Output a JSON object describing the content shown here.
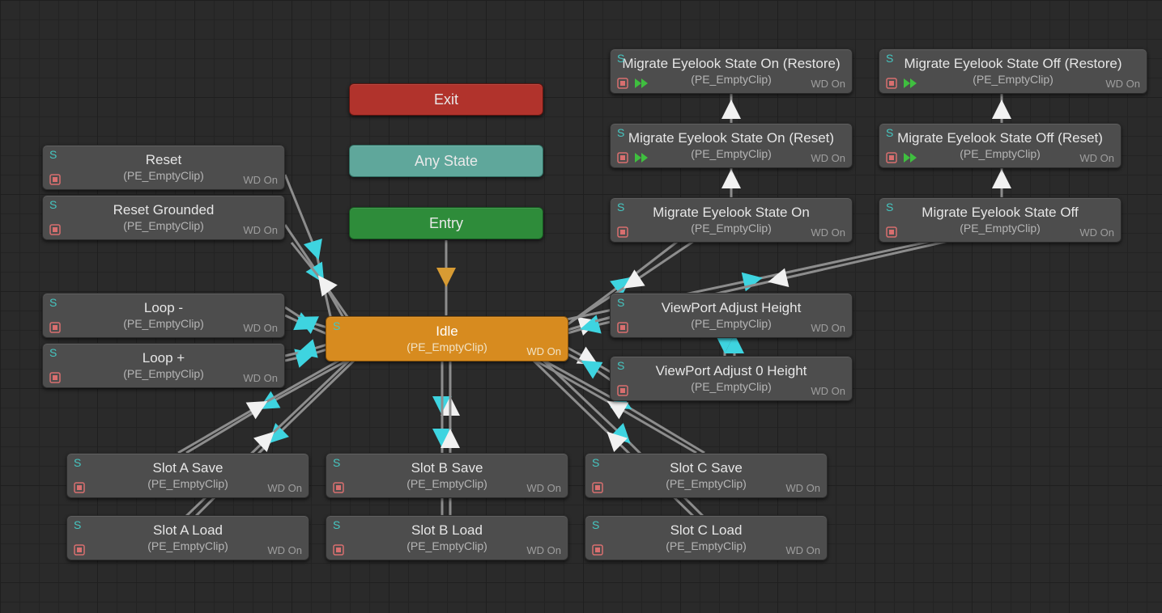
{
  "colors": {
    "idle": "#d78b1f",
    "exit": "#b1332c",
    "anyState": "#5fa79b",
    "entry": "#2e8c3a",
    "state": "#4d4d4d",
    "sTag": "#45c6c1",
    "arrowCyan": "#3ed4e0",
    "arrowWhite": "#f1f1f1",
    "micIcon": "#d86f6f",
    "ffIcon": "#3fbf3f"
  },
  "wd": "WD On",
  "sTag": "S",
  "clip": "(PE_EmptyClip)",
  "nodes": {
    "exit": {
      "label": "Exit"
    },
    "anyState": {
      "label": "Any State"
    },
    "entry": {
      "label": "Entry"
    },
    "idle": {
      "label": "Idle"
    },
    "reset": {
      "label": "Reset"
    },
    "resetGrounded": {
      "label": "Reset Grounded"
    },
    "loopMinus": {
      "label": "Loop -"
    },
    "loopPlus": {
      "label": "Loop +"
    },
    "vpAdjHeight": {
      "label": "ViewPort Adjust Height"
    },
    "vpAdj0Height": {
      "label": "ViewPort Adjust 0 Height"
    },
    "slotASave": {
      "label": "Slot A Save"
    },
    "slotALoad": {
      "label": "Slot A Load"
    },
    "slotBSave": {
      "label": "Slot B Save"
    },
    "slotBLoad": {
      "label": "Slot B Load"
    },
    "slotCSave": {
      "label": "Slot C Save"
    },
    "slotCLoad": {
      "label": "Slot C Load"
    },
    "migOnRestore": {
      "label": "Migrate Eyelook State On (Restore)"
    },
    "migOnReset": {
      "label": "Migrate Eyelook State On (Reset)"
    },
    "migOn": {
      "label": "Migrate Eyelook State On"
    },
    "migOffRestore": {
      "label": "Migrate Eyelook State Off (Restore)"
    },
    "migOffReset": {
      "label": "Migrate Eyelook State Off (Reset)"
    },
    "migOff": {
      "label": "Migrate Eyelook State Off"
    }
  }
}
